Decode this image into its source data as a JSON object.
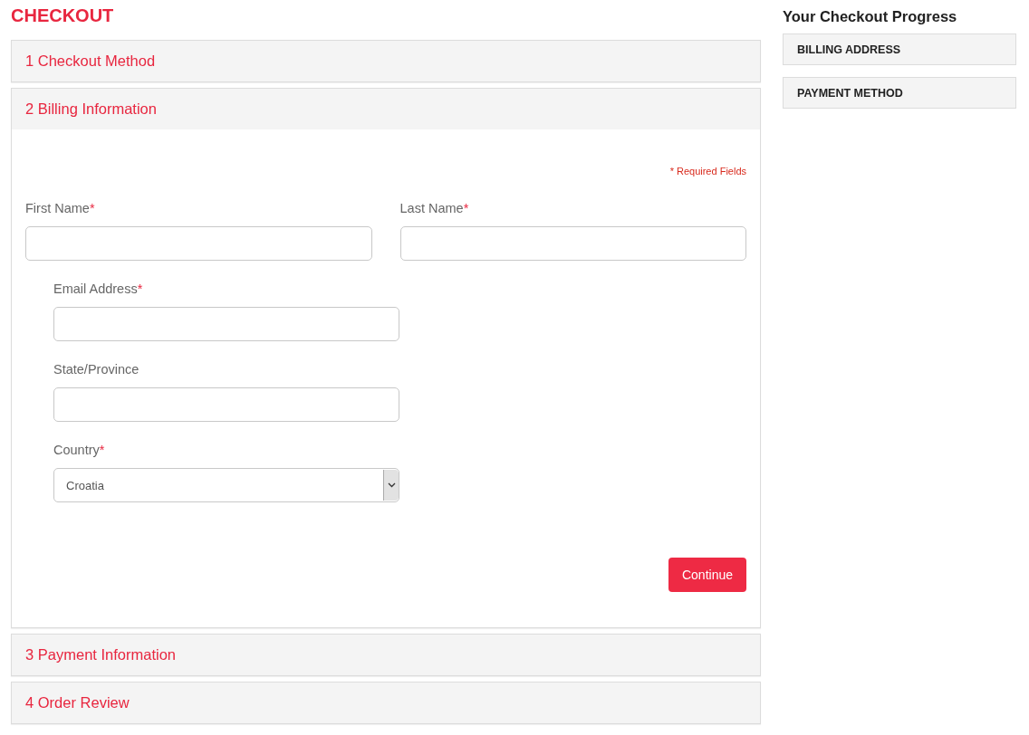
{
  "page_title": "CHECKOUT",
  "sections": [
    {
      "number": "1",
      "title": "Checkout Method",
      "expanded": false
    },
    {
      "number": "2",
      "title": "Billing Information",
      "expanded": true
    },
    {
      "number": "3",
      "title": "Payment Information",
      "expanded": false
    },
    {
      "number": "4",
      "title": "Order Review",
      "expanded": false
    }
  ],
  "billing_form": {
    "required_note": "* Required Fields",
    "required_mark": "*",
    "name_fields": [
      {
        "kind": "text",
        "label": "First Name",
        "required": true
      },
      {
        "kind": "text",
        "label": "Last Name",
        "required": true
      }
    ],
    "fields": [
      {
        "kind": "text",
        "label": "Email Address",
        "required": true
      },
      {
        "kind": "text",
        "label": "State/Province",
        "required": false
      },
      {
        "kind": "select",
        "label": "Country",
        "required": true,
        "value": "Croatia"
      }
    ],
    "submit_button": "Continue"
  },
  "progress": {
    "title": "Your Checkout Progress",
    "items": [
      {
        "label": "BILLING ADDRESS"
      },
      {
        "label": "PAYMENT METHOD"
      }
    ]
  }
}
